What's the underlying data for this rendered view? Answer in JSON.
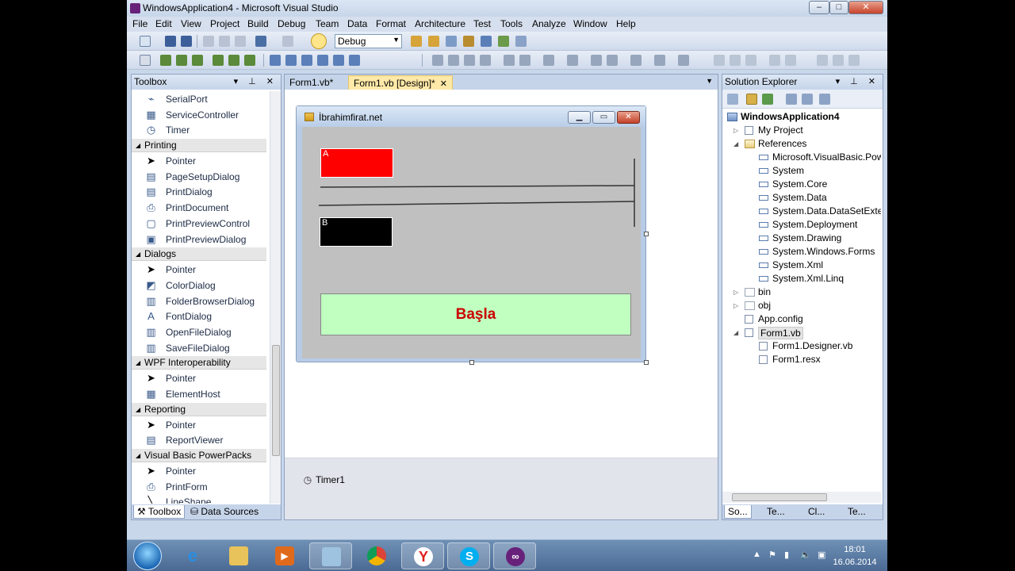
{
  "window": {
    "title": "WindowsApplication4 - Microsoft Visual Studio"
  },
  "menu": [
    "File",
    "Edit",
    "View",
    "Project",
    "Build",
    "Debug",
    "Team",
    "Data",
    "Format",
    "Architecture",
    "Test",
    "Tools",
    "Analyze",
    "Window",
    "Help"
  ],
  "toolbar": {
    "config": "Debug"
  },
  "toolbox": {
    "title": "Toolbox",
    "groups": [
      {
        "header": null,
        "items": [
          "SerialPort",
          "ServiceController",
          "Timer"
        ]
      },
      {
        "header": "Printing",
        "items": [
          "Pointer",
          "PageSetupDialog",
          "PrintDialog",
          "PrintDocument",
          "PrintPreviewControl",
          "PrintPreviewDialog"
        ]
      },
      {
        "header": "Dialogs",
        "items": [
          "Pointer",
          "ColorDialog",
          "FolderBrowserDialog",
          "FontDialog",
          "OpenFileDialog",
          "SaveFileDialog"
        ]
      },
      {
        "header": "WPF Interoperability",
        "items": [
          "Pointer",
          "ElementHost"
        ]
      },
      {
        "header": "Reporting",
        "items": [
          "Pointer",
          "ReportViewer"
        ]
      },
      {
        "header": "Visual Basic PowerPacks",
        "items": [
          "Pointer",
          "PrintForm",
          "LineShape"
        ]
      }
    ],
    "tabs": [
      "Toolbox",
      "Data Sources"
    ]
  },
  "documents": {
    "tabs": [
      "Form1.vb*",
      "Form1.vb [Design]*"
    ]
  },
  "form": {
    "title": "İbrahimfirat.net",
    "label_a": "A",
    "label_b": "B",
    "button": "Başla",
    "colors": {
      "label_a": "#ff0000",
      "label_b": "#000000",
      "button_bg": "#c0ffc0",
      "button_text": "#cc0000"
    }
  },
  "tray": {
    "component": "Timer1"
  },
  "solution_explorer": {
    "title": "Solution Explorer",
    "nodes": [
      {
        "label": "WindowsApplication4",
        "level": 0,
        "bold": true,
        "icon": "proj"
      },
      {
        "label": "My Project",
        "level": 1,
        "expander": "closed",
        "icon": "file"
      },
      {
        "label": "References",
        "level": 1,
        "expander": "open",
        "icon": "folder"
      },
      {
        "label": "Microsoft.VisualBasic.PowerPacks",
        "level": 2,
        "icon": "ref"
      },
      {
        "label": "System",
        "level": 2,
        "icon": "ref"
      },
      {
        "label": "System.Core",
        "level": 2,
        "icon": "ref"
      },
      {
        "label": "System.Data",
        "level": 2,
        "icon": "ref"
      },
      {
        "label": "System.Data.DataSetExtensions",
        "level": 2,
        "icon": "ref"
      },
      {
        "label": "System.Deployment",
        "level": 2,
        "icon": "ref"
      },
      {
        "label": "System.Drawing",
        "level": 2,
        "icon": "ref"
      },
      {
        "label": "System.Windows.Forms",
        "level": 2,
        "icon": "ref"
      },
      {
        "label": "System.Xml",
        "level": 2,
        "icon": "ref"
      },
      {
        "label": "System.Xml.Linq",
        "level": 2,
        "icon": "ref"
      },
      {
        "label": "bin",
        "level": 1,
        "expander": "closed",
        "icon": "emptyfolder"
      },
      {
        "label": "obj",
        "level": 1,
        "expander": "closed",
        "icon": "emptyfolder"
      },
      {
        "label": "App.config",
        "level": 1,
        "icon": "file"
      },
      {
        "label": "Form1.vb",
        "level": 1,
        "expander": "open",
        "icon": "file",
        "selected": true
      },
      {
        "label": "Form1.Designer.vb",
        "level": 2,
        "icon": "file"
      },
      {
        "label": "Form1.resx",
        "level": 2,
        "icon": "file"
      }
    ],
    "tabs": [
      "So...",
      "Te...",
      "Cl...",
      "Te..."
    ]
  },
  "taskbar": {
    "time": "18:01",
    "date": "16.06.2014"
  }
}
